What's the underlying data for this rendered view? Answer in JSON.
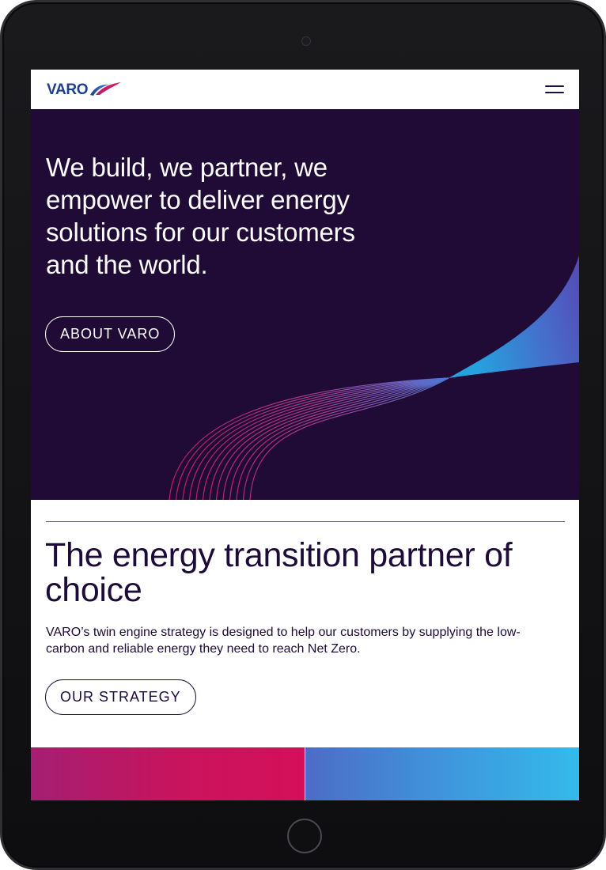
{
  "header": {
    "logo_text": "VARO",
    "menu_icon": "hamburger-menu-icon"
  },
  "hero": {
    "title": "We build, we partner, we empower to deliver energy solutions for our customers and the world.",
    "button_label": "ABOUT VARO"
  },
  "intro": {
    "title": "The energy transition partner of choice",
    "text": "VARO’s twin engine strategy is designed to help our customers by supplying the low-carbon and reliable energy they need to reach Net Zero.",
    "button_label": "OUR STRATEGY"
  },
  "colors": {
    "brand_navy": "#1d0b3a",
    "hero_background": "#1f0b36",
    "logo_blue": "#1e3f8f",
    "accent_magenta": "#d50f5a",
    "accent_cyan": "#34baeb"
  }
}
